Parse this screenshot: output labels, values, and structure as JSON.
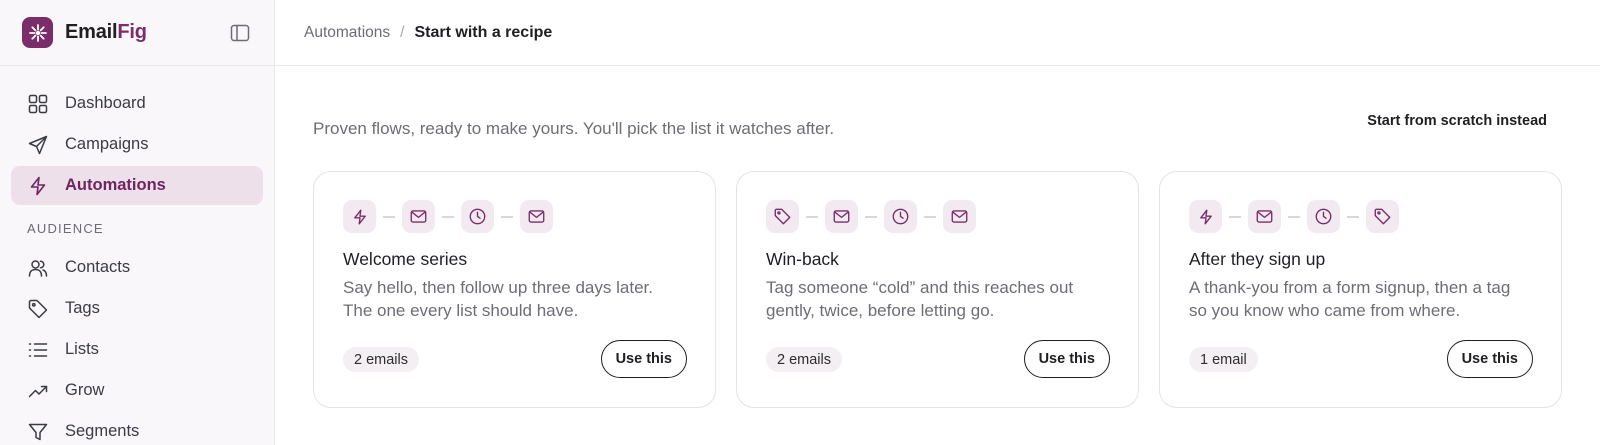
{
  "brand": {
    "name_main": "Email",
    "name_accent": "Fig",
    "accent_color": "#7b2d69"
  },
  "sidebar": {
    "items": [
      {
        "label": "Dashboard",
        "icon": "grid-icon"
      },
      {
        "label": "Campaigns",
        "icon": "send-icon"
      },
      {
        "label": "Automations",
        "icon": "bolt-icon",
        "active": true
      }
    ],
    "section_label": "AUDIENCE",
    "audience_items": [
      {
        "label": "Contacts",
        "icon": "users-icon"
      },
      {
        "label": "Tags",
        "icon": "tag-icon"
      },
      {
        "label": "Lists",
        "icon": "list-icon"
      },
      {
        "label": "Grow",
        "icon": "trending-up-icon"
      },
      {
        "label": "Segments",
        "icon": "filter-icon"
      }
    ]
  },
  "breadcrumb": {
    "parent": "Automations",
    "separator": "/",
    "current": "Start with a recipe"
  },
  "intro": "Proven flows, ready to make yours. You'll pick the list it watches after.",
  "scratch_link": "Start from scratch instead",
  "recipes": [
    {
      "title": "Welcome series",
      "description": "Say hello, then follow up three days later. The one every list should have.",
      "steps": [
        "bolt-icon",
        "mail-icon",
        "clock-icon",
        "mail-icon"
      ],
      "badge": "2 emails",
      "button": "Use this"
    },
    {
      "title": "Win-back",
      "description": "Tag someone “cold” and this reaches out gently, twice, before letting go.",
      "steps": [
        "tag-icon",
        "mail-icon",
        "clock-icon",
        "mail-icon"
      ],
      "badge": "2 emails",
      "button": "Use this"
    },
    {
      "title": "After they sign up",
      "description": "A thank-you from a form signup, then a tag so you know who came from where.",
      "steps": [
        "bolt-icon",
        "mail-icon",
        "clock-icon",
        "tag-icon"
      ],
      "badge": "1 email",
      "button": "Use this"
    }
  ]
}
